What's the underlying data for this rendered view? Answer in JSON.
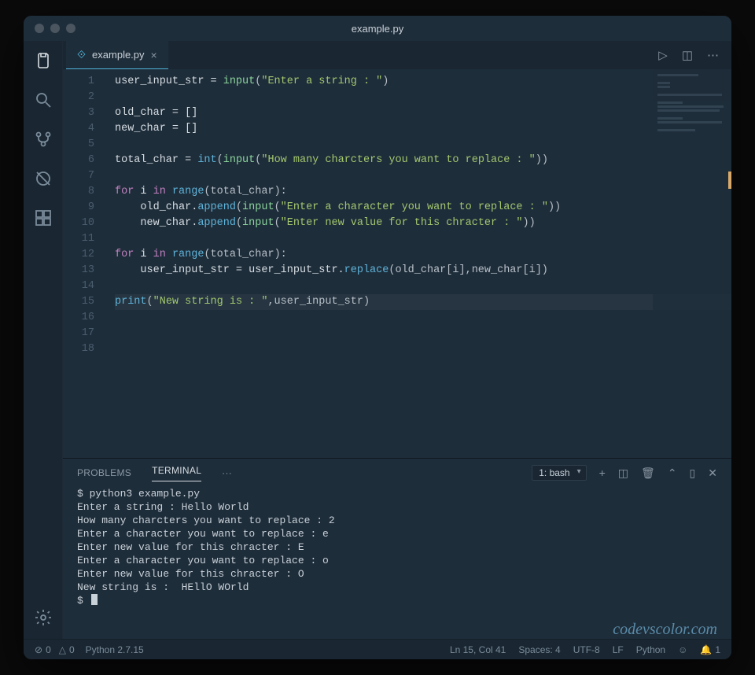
{
  "window": {
    "title": "example.py"
  },
  "tab": {
    "icon_glyph": "⟐",
    "label": "example.py"
  },
  "editor_actions": {
    "run": "▷",
    "split": "◫",
    "more": "⋯"
  },
  "code": {
    "lines": [
      {
        "n": "1",
        "tokens": [
          {
            "t": "user_input_str",
            "c": "t-var"
          },
          {
            "t": " = ",
            "c": "t-op"
          },
          {
            "t": "input",
            "c": "t-call"
          },
          {
            "t": "(",
            "c": "t-punct"
          },
          {
            "t": "\"Enter a string : \"",
            "c": "t-str"
          },
          {
            "t": ")",
            "c": "t-punct"
          }
        ]
      },
      {
        "n": "2",
        "tokens": []
      },
      {
        "n": "3",
        "tokens": [
          {
            "t": "old_char",
            "c": "t-var"
          },
          {
            "t": " = []",
            "c": "t-op"
          }
        ]
      },
      {
        "n": "4",
        "tokens": [
          {
            "t": "new_char",
            "c": "t-var"
          },
          {
            "t": " = []",
            "c": "t-op"
          }
        ]
      },
      {
        "n": "5",
        "tokens": []
      },
      {
        "n": "6",
        "tokens": [
          {
            "t": "total_char",
            "c": "t-var"
          },
          {
            "t": " = ",
            "c": "t-op"
          },
          {
            "t": "int",
            "c": "t-func"
          },
          {
            "t": "(",
            "c": "t-punct"
          },
          {
            "t": "input",
            "c": "t-call"
          },
          {
            "t": "(",
            "c": "t-punct"
          },
          {
            "t": "\"How many charcters you want to replace : \"",
            "c": "t-str"
          },
          {
            "t": "))",
            "c": "t-punct"
          }
        ]
      },
      {
        "n": "7",
        "tokens": []
      },
      {
        "n": "8",
        "tokens": [
          {
            "t": "for",
            "c": "t-kw"
          },
          {
            "t": " i ",
            "c": "t-var"
          },
          {
            "t": "in",
            "c": "t-kw"
          },
          {
            "t": " ",
            "c": ""
          },
          {
            "t": "range",
            "c": "t-func"
          },
          {
            "t": "(total_char):",
            "c": "t-punct"
          }
        ]
      },
      {
        "n": "9",
        "tokens": [
          {
            "t": "    old_char.",
            "c": "t-var"
          },
          {
            "t": "append",
            "c": "t-func"
          },
          {
            "t": "(",
            "c": "t-punct"
          },
          {
            "t": "input",
            "c": "t-call"
          },
          {
            "t": "(",
            "c": "t-punct"
          },
          {
            "t": "\"Enter a character you want to replace : \"",
            "c": "t-str"
          },
          {
            "t": "))",
            "c": "t-punct"
          }
        ]
      },
      {
        "n": "10",
        "tokens": [
          {
            "t": "    new_char.",
            "c": "t-var"
          },
          {
            "t": "append",
            "c": "t-func"
          },
          {
            "t": "(",
            "c": "t-punct"
          },
          {
            "t": "input",
            "c": "t-call"
          },
          {
            "t": "(",
            "c": "t-punct"
          },
          {
            "t": "\"Enter new value for this chracter : \"",
            "c": "t-str"
          },
          {
            "t": "))",
            "c": "t-punct"
          }
        ]
      },
      {
        "n": "11",
        "tokens": []
      },
      {
        "n": "12",
        "tokens": [
          {
            "t": "for",
            "c": "t-kw"
          },
          {
            "t": " i ",
            "c": "t-var"
          },
          {
            "t": "in",
            "c": "t-kw"
          },
          {
            "t": " ",
            "c": ""
          },
          {
            "t": "range",
            "c": "t-func"
          },
          {
            "t": "(total_char):",
            "c": "t-punct"
          }
        ]
      },
      {
        "n": "13",
        "tokens": [
          {
            "t": "    user_input_str = user_input_str.",
            "c": "t-var"
          },
          {
            "t": "replace",
            "c": "t-func"
          },
          {
            "t": "(old_char[i],new_char[i])",
            "c": "t-punct"
          }
        ]
      },
      {
        "n": "14",
        "tokens": []
      },
      {
        "n": "15",
        "current": true,
        "tokens": [
          {
            "t": "print",
            "c": "t-func"
          },
          {
            "t": "(",
            "c": "t-punct"
          },
          {
            "t": "\"New string is : \"",
            "c": "t-str"
          },
          {
            "t": ",user_input_str)",
            "c": "t-punct"
          }
        ]
      },
      {
        "n": "16",
        "tokens": []
      },
      {
        "n": "17",
        "tokens": []
      },
      {
        "n": "18",
        "tokens": []
      }
    ]
  },
  "panel": {
    "tabs": {
      "problems": "PROBLEMS",
      "terminal": "TERMINAL",
      "more": "···"
    },
    "terminal_select": "1: bash",
    "actions": {
      "new": "+",
      "split": "◫",
      "trash": "🗑",
      "up": "⌃",
      "max": "▯",
      "close": "✕"
    }
  },
  "terminal": {
    "lines": [
      "$ python3 example.py",
      "Enter a string : Hello World",
      "How many charcters you want to replace : 2",
      "Enter a character you want to replace : e",
      "Enter new value for this chracter : E",
      "Enter a character you want to replace : o",
      "Enter new value for this chracter : O",
      "New string is :  HEllO WOrld",
      "$ "
    ]
  },
  "watermark": "codevscolor.com",
  "status": {
    "errors": "0",
    "warnings": "0",
    "lang_version": "Python 2.7.15",
    "cursor": "Ln 15, Col 41",
    "spaces": "Spaces: 4",
    "encoding": "UTF-8",
    "eol": "LF",
    "language": "Python",
    "bell": "1"
  }
}
